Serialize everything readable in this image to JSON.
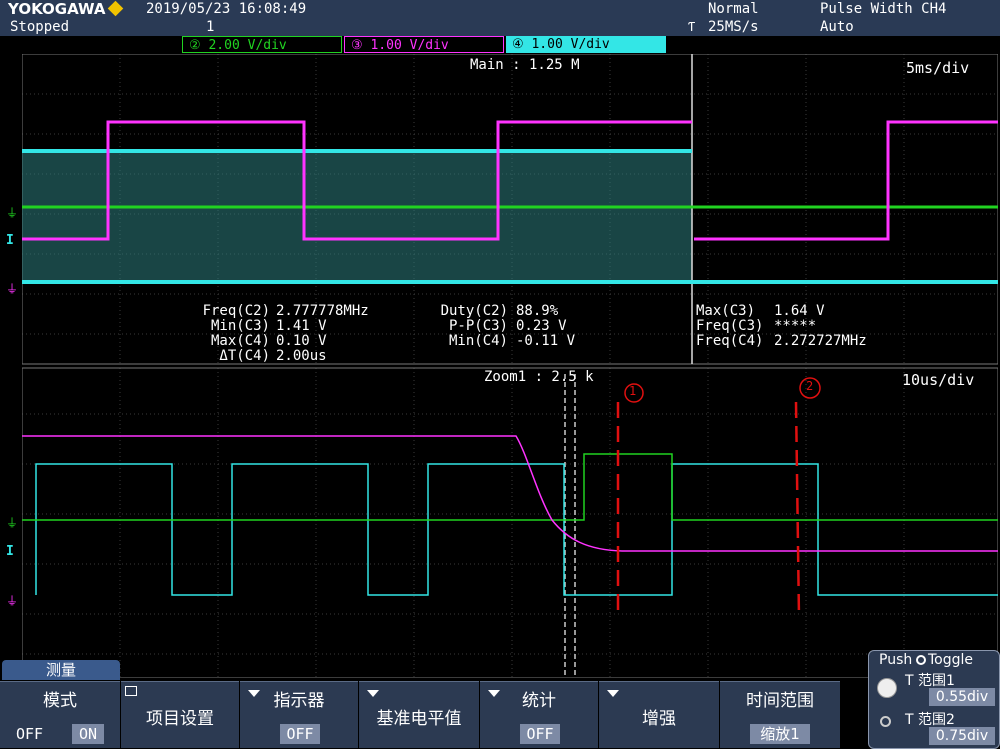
{
  "header": {
    "brand": "YOKOGAWA",
    "status": "Stopped",
    "datetime": "2019/05/23  16:08:49",
    "acq_count": "1",
    "trigger_mode": "Normal",
    "sample_rate": "25MS/s",
    "trigger_type": "Pulse Width CH4",
    "trigger_auto": "Auto",
    "trigger_edge_symbol": "Ƭ"
  },
  "channels": [
    {
      "num": "②",
      "scale": "2.00 V/div",
      "color": "#21d321"
    },
    {
      "num": "③",
      "scale": "1.00 V/div",
      "color": "#ff33ff"
    },
    {
      "num": "④",
      "scale": "1.00 V/div",
      "color": "#33e6e6"
    }
  ],
  "main_window": {
    "label": "Main : 1.25 M",
    "timebase": "5ms/div",
    "measurements": {
      "col1_labels": "Freq(C2)\nMin(C3)\nMax(C4)\nΔT(C4)",
      "col1_values": "2.777778MHz\n1.41 V\n0.10 V\n2.00us",
      "col2_labels": "Duty(C2)\nP-P(C3)\nMin(C4)",
      "col2_values": "88.9%\n0.23 V\n-0.11 V",
      "col3_labels": "Max(C3)\nFreq(C3)\nFreq(C4)",
      "col3_values": "1.64 V\n*****\n2.272727MHz"
    }
  },
  "zoom_window": {
    "label": "Zoom1 : 2.5 k",
    "timebase": "10us/div",
    "annotation_1": "1",
    "annotation_2": "2"
  },
  "softkeys": {
    "measure_title": "测量",
    "mode": {
      "label": "模式",
      "off": "OFF",
      "on": "ON"
    },
    "item_setup": {
      "label": "项目设置"
    },
    "indicator": {
      "label": "指示器",
      "value": "OFF"
    },
    "ref_level": {
      "label": "基准电平值"
    },
    "stats": {
      "label": "统计",
      "value": "OFF"
    },
    "enhance": {
      "label": "增强"
    },
    "time_range": {
      "label": "时间范围",
      "value": "缩放1"
    }
  },
  "range_panel": {
    "title": "Push",
    "toggle": "Toggle",
    "t1_label": "T  范围1",
    "t1_value": "0.55div",
    "t2_label": "T  范围2",
    "t2_value": "0.75div"
  },
  "colors": {
    "ch2": "#21d321",
    "ch3": "#ff33ff",
    "ch4": "#33e6e6",
    "annotation": "#e01010",
    "grid": "#3a3a3a",
    "ui_panel": "#2c3a52"
  }
}
